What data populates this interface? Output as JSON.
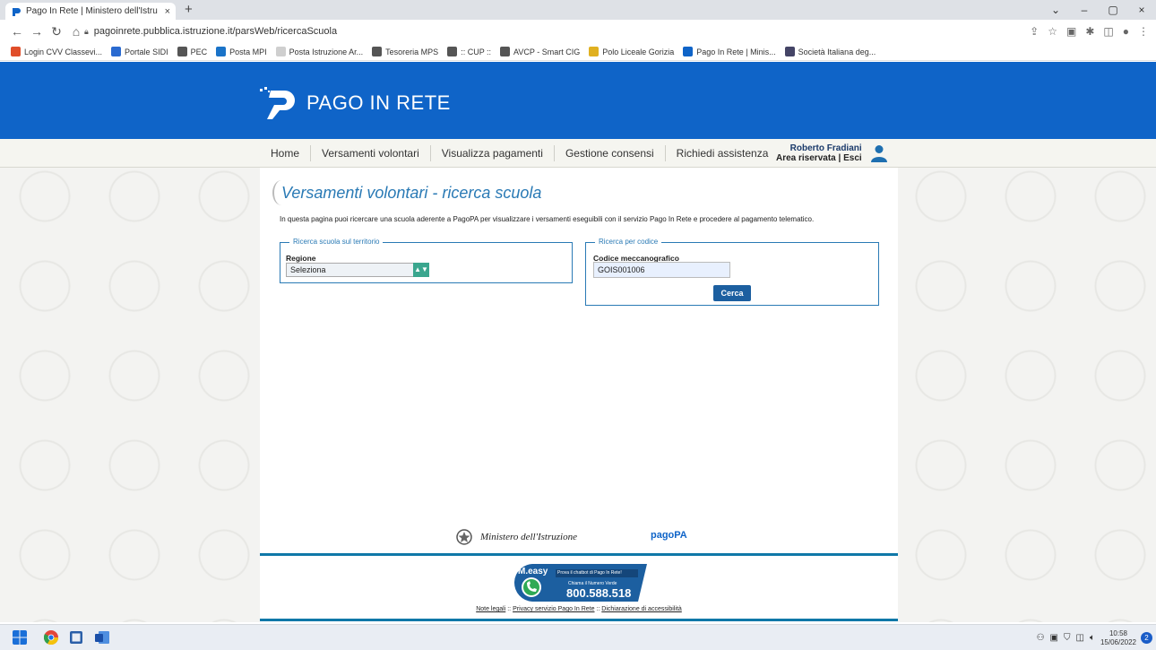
{
  "browser": {
    "tab_title": "Pago In Rete | Ministero dell'Istru",
    "tab_close": "×",
    "new_tab": "+",
    "url": "pagoinrete.pubblica.istruzione.it/parsWeb/ricercaScuola",
    "window_controls": {
      "collapse": "⌄",
      "minimize": "–",
      "maximize": "▢",
      "close": "×"
    }
  },
  "bookmarks": [
    {
      "label": "Login CVV Classevi...",
      "color": "#e04e2a"
    },
    {
      "label": "Portale SIDI",
      "color": "#2a6ad0"
    },
    {
      "label": "PEC",
      "color": "#555555"
    },
    {
      "label": "Posta MPI",
      "color": "#1a73c8"
    },
    {
      "label": "Posta Istruzione Ar...",
      "color": "#cfcfcf"
    },
    {
      "label": "Tesoreria MPS",
      "color": "#555555"
    },
    {
      "label": ":: CUP ::",
      "color": "#555555"
    },
    {
      "label": "AVCP - Smart CIG",
      "color": "#555555"
    },
    {
      "label": "Polo Liceale Gorizia",
      "color": "#e0b020"
    },
    {
      "label": "Pago In Rete | Minis...",
      "color": "#0f64c8"
    },
    {
      "label": "Società Italiana deg...",
      "color": "#444466"
    }
  ],
  "header": {
    "brand": "PAGO IN RETE"
  },
  "menu": {
    "items": [
      {
        "label": "Home"
      },
      {
        "label": "Versamenti volontari"
      },
      {
        "label": "Visualizza pagamenti"
      },
      {
        "label": "Gestione consensi"
      },
      {
        "label": "Richiedi assistenza"
      }
    ],
    "user_name": "Roberto Fradiani",
    "reserved_area": "Area riservata",
    "separator": "|",
    "logout": "Esci"
  },
  "main": {
    "title": "Versamenti volontari - ricerca scuola",
    "intro": "In questa pagina puoi ricercare una scuola aderente a PagoPA per visualizzare i versamenti eseguibili con il servizio Pago In Rete e procedere al pagamento telematico.",
    "territory": {
      "legend": "Ricerca scuola sul territorio",
      "region_label": "Regione",
      "region_value": "Seleziona"
    },
    "code_search": {
      "legend": "Ricerca per codice",
      "code_label": "Codice meccanografico",
      "code_value": "GOIS001006",
      "search_button": "Cerca"
    }
  },
  "footer": {
    "ministry": "Ministero dell'Istruzione",
    "pagopa": "pagoPA",
    "meeasy_brand": "M.easy",
    "meeasy_tagline": "Prova il chatbot di Pago In Rete!",
    "meeasy_call": "Chiama il Numero Verde",
    "phone": "800.588.518",
    "links": [
      "Note legali",
      "Privacy servizio Pago In Rete",
      "Dichiarazione di accessibilità"
    ],
    "link_separator": "::"
  },
  "taskbar": {
    "time": "10:58",
    "date": "15/06/2022",
    "notifications": "2"
  }
}
